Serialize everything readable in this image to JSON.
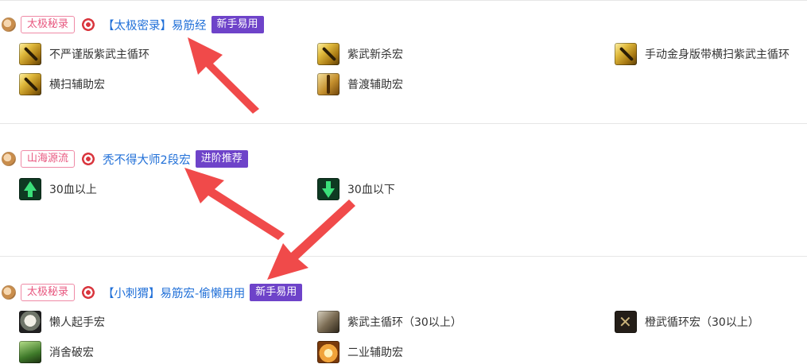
{
  "macros": [
    {
      "tag": "太极秘录",
      "title": "【太极密录】易筋经",
      "badge": "新手易用",
      "skills": [
        {
          "label": "不严谨版紫武主循环",
          "icon": "gold-blade-icon"
        },
        {
          "label": "紫武新杀宏",
          "icon": "gold-blade-icon"
        },
        {
          "label": "手动金身版带横扫紫武主循环",
          "icon": "gold-blade-icon"
        },
        {
          "label": "横扫辅助宏",
          "icon": "gold-blade-icon"
        },
        {
          "label": "普渡辅助宏",
          "icon": "golden-staff-icon"
        }
      ]
    },
    {
      "tag": "山海源流",
      "title": "秃不得大师2段宏",
      "badge": "进阶推荐",
      "skills": [
        {
          "label": "30血以上",
          "icon": "green-up-arrow-icon"
        },
        {
          "label": "30血以下",
          "icon": "green-down-arrow-icon"
        }
      ]
    },
    {
      "tag": "太极秘录",
      "title": "【小刺猬】易筋宏-偷懒用用",
      "badge": "新手易用",
      "skills": [
        {
          "label": "懒人起手宏",
          "icon": "ghost-icon"
        },
        {
          "label": "紫武主循环（30以上）",
          "icon": "beast-icon"
        },
        {
          "label": "橙武循环宏（30以上）",
          "icon": "crossed-weapons-icon"
        },
        {
          "label": "消舍破宏",
          "icon": "leaf-icon"
        },
        {
          "label": "二业辅助宏",
          "icon": "flame-icon"
        }
      ]
    }
  ],
  "colors": {
    "tag_border": "#ef8aa6",
    "tag_text": "#e8577f",
    "title": "#2170d8",
    "badge_bg": "#6e43c9",
    "annotation_arrow": "#f04a4a"
  }
}
